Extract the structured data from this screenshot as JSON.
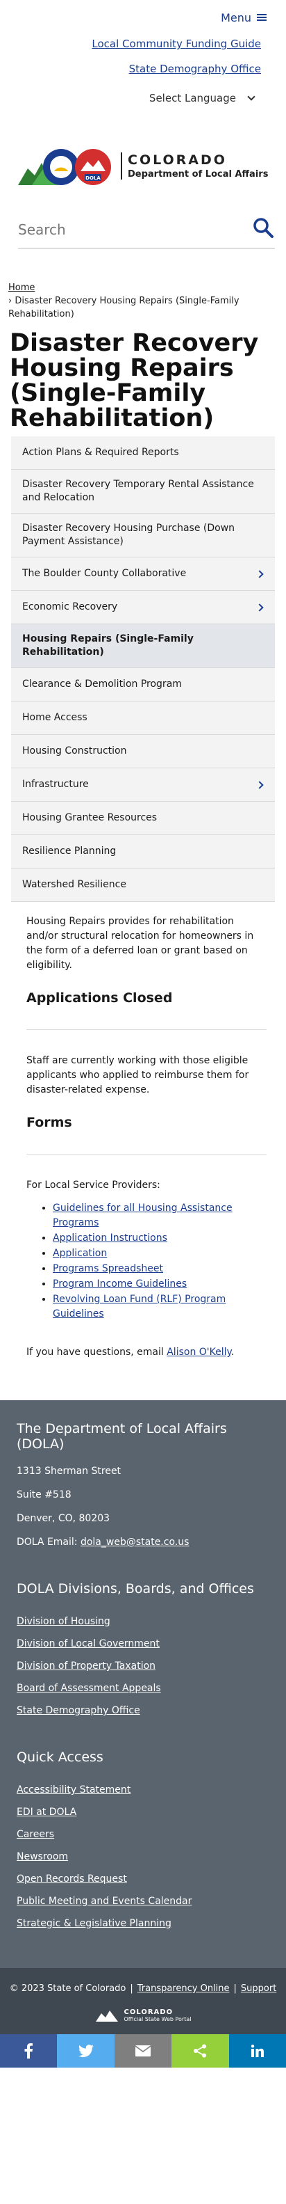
{
  "header": {
    "menu_label": "Menu",
    "links": [
      "Local Community Funding Guide",
      "State Demography Office"
    ],
    "language_label": "Select Language"
  },
  "logo": {
    "state": "COLORADO",
    "dept": "Department of Local Affairs",
    "badge": "DOLA"
  },
  "search": {
    "placeholder": "Search"
  },
  "breadcrumb": {
    "home": "Home",
    "current": "Disaster Recovery Housing Repairs (Single-Family Rehabilitation)"
  },
  "page": {
    "title": "Disaster Recovery Housing Repairs (Single-Family Rehabilitation)"
  },
  "side_nav": [
    {
      "label": "Action Plans & Required Reports"
    },
    {
      "label": "Disaster Recovery Temporary Rental Assistance and Relocation"
    },
    {
      "label": "Disaster Recovery Housing Purchase (Down Payment Assistance)"
    },
    {
      "label": "The Boulder County Collaborative"
    },
    {
      "label": "Economic Recovery"
    },
    {
      "label": "Housing Repairs (Single-Family Rehabilitation)"
    },
    {
      "label": "Clearance & Demolition Program"
    },
    {
      "label": "Home Access"
    },
    {
      "label": "Housing Construction"
    },
    {
      "label": "Infrastructure"
    },
    {
      "label": "Housing Grantee Resources"
    },
    {
      "label": "Resilience Planning"
    },
    {
      "label": "Watershed Resilience"
    }
  ],
  "content": {
    "intro": "Housing Repairs provides for rehabilitation and/or structural relocation for homeowners in the form of a deferred loan or grant based on eligibility.",
    "applications_heading": "Applications Closed",
    "applications_text": "Staff are currently working with those eligible applicants who applied to reimburse them for disaster-related expense.",
    "forms_heading": "Forms",
    "forms_intro": "For Local Service Providers:",
    "forms": [
      "Guidelines for all Housing Assistance Programs",
      "Application Instructions",
      "Application",
      "Programs Spreadsheet",
      "Program Income Guidelines",
      "Revolving Loan Fund (RLF) Program Guidelines"
    ],
    "contact_prefix": "If you have questions, email ",
    "contact_name": "Alison O'Kelly",
    "contact_suffix": "."
  },
  "footer": {
    "org_title": "The Department of Local Affairs (DOLA)",
    "address1": "1313 Sherman Street",
    "address2": "Suite #518",
    "address3": "Denver, CO, 80203",
    "email_label": "DOLA Email: ",
    "email": "dola_web@state.co.us",
    "divisions_title": "DOLA Divisions, Boards, and Offices",
    "divisions": [
      "Division of Housing",
      "Division of Local Government",
      "Division of Property Taxation",
      "Board of Assessment Appeals",
      "State Demography Office"
    ],
    "quick_title": "Quick Access",
    "quick": [
      "Accessibility Statement",
      "EDI at DOLA",
      "Careers",
      "Newsroom",
      "Open Records Request",
      "Public Meeting and Events Calendar",
      "Strategic & Legislative Planning"
    ]
  },
  "bottom": {
    "copyright": "© 2023 State of Colorado",
    "transparency": "Transparency Online",
    "support": "Support",
    "official_state": "COLORADO",
    "official_sub": "Official State Web Portal"
  },
  "share_bar": [
    {
      "icon": "facebook-icon",
      "color": "#3b5998"
    },
    {
      "icon": "twitter-icon",
      "color": "#55acee"
    },
    {
      "icon": "email-icon",
      "color": "#7f7f7f"
    },
    {
      "icon": "share-icon",
      "color": "#95d03a"
    },
    {
      "icon": "linkedin-icon",
      "color": "#0077b5"
    }
  ]
}
